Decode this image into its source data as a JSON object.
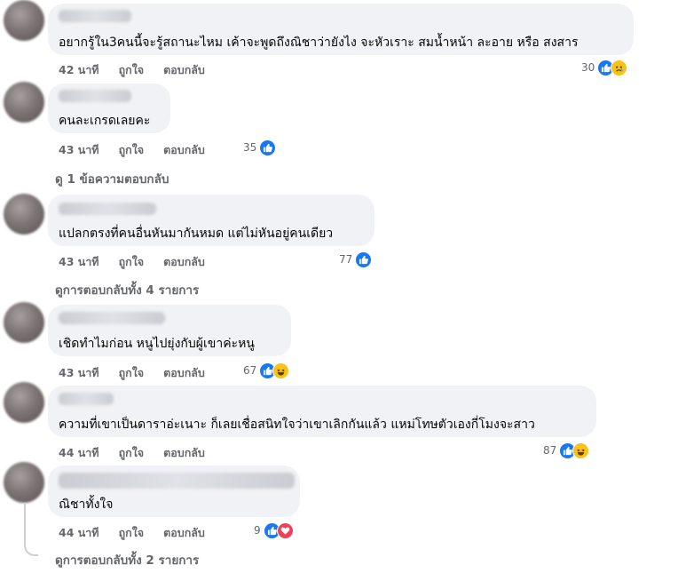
{
  "comments": [
    {
      "text": "อยากรู้ใน3คนนี้จะรู้สถานะไหม เค้าจะพูดถึงณิชาว่ายังไง จะหัวเราะ สมน้ำหน้า ละอาย หรือ สงสาร",
      "time": "42 นาที",
      "like": "ถูกใจ",
      "reply": "ตอบกลับ",
      "reactions": "30",
      "icons": [
        "like-icon",
        "sad-icon"
      ]
    },
    {
      "text": "คนละเกรดเลยคะ",
      "time": "43 นาที",
      "like": "ถูกใจ",
      "reply": "ตอบกลับ",
      "reactions": "35",
      "icons": [
        "like-icon"
      ],
      "view_replies": "ดู 1 ข้อความตอบกลับ"
    },
    {
      "text": "แปลกตรงที่คนอื่นหันมากันหมด แต่ไม่หันอยู่คนเดียว",
      "time": "43 นาที",
      "like": "ถูกใจ",
      "reply": "ตอบกลับ",
      "reactions": "77",
      "icons": [
        "like-icon"
      ],
      "view_replies": "ดูการตอบกลับทั้ง 4 รายการ"
    },
    {
      "text": "เชิดทำไมก่อน หนูไปยุ่งกับผู้เขาค่ะหนู",
      "time": "43 นาที",
      "like": "ถูกใจ",
      "reply": "ตอบกลับ",
      "reactions": "67",
      "icons": [
        "like-icon",
        "haha-icon"
      ]
    },
    {
      "text": "ความที่เขาเป็นดาราอ่ะเนาะ ก็เลยเชื่อสนิทใจว่าเขาเลิกกันแล้ว แหม่โทษตัวเองกี่โมงจะสาว",
      "time": "44 นาที",
      "like": "ถูกใจ",
      "reply": "ตอบกลับ",
      "reactions": "87",
      "icons": [
        "like-icon",
        "haha-icon"
      ]
    },
    {
      "text": "ณิชาทั้งใจ",
      "time": "44 นาที",
      "like": "ถูกใจ",
      "reply": "ตอบกลับ",
      "reactions": "9",
      "icons": [
        "like-icon",
        "love-icon"
      ],
      "view_replies": "ดูการตอบกลับทั้ง 2 รายการ"
    }
  ]
}
